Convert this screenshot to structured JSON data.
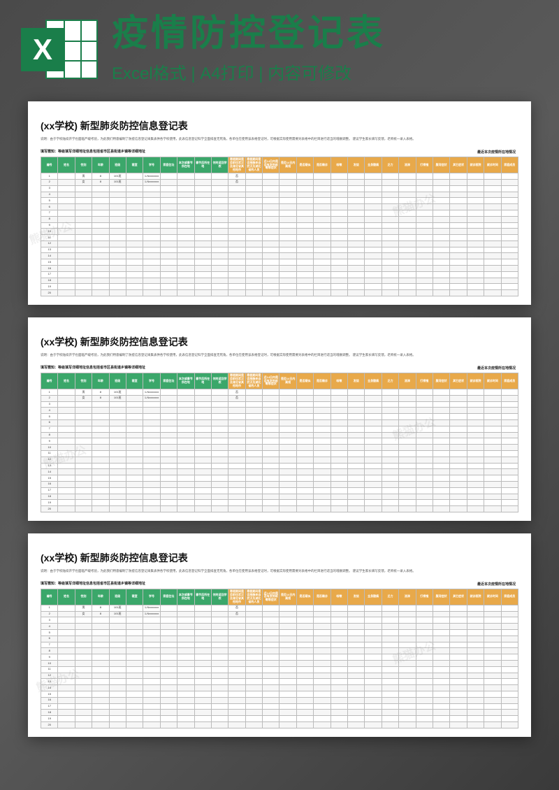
{
  "header": {
    "main_title": "疫情防控登记表",
    "sub_title": "Excel格式 | A4打印 | 内容可修改",
    "icon_letter": "X"
  },
  "page": {
    "title": "(xx学校) 新型肺炎防控信息登记表",
    "desc_line1": "说明：由于学校陆续开学也面临严峻考验，为此我们特意编制了防疫信息登记采集表供各学校使用，此表信息登记科学全面排查无死角，各单位在使用该表格登记时，可根据实际使用需要对表格中的栏目进行适当的增删调整。",
    "desc_line2": "建议学生家长填写反馈，老师统一录入表格。",
    "left_banner": "填写需知：等级填写详细地址信息包括省市区县街道乡镇等详细地址",
    "right_banner": "最近本次疫情所在地情况"
  },
  "columns_green": [
    "编号",
    "姓名",
    "性别",
    "年龄",
    "班级",
    "寝室",
    "学号",
    "家庭住址",
    "本次或春节所在地",
    "春节后所在地",
    "何时返回学校"
  ],
  "columns_orange_pre": [
    "寒假期间是否前往武汉及湖北省其他地市",
    "寒假期间是否接触来自武汉及湖北省的人员",
    "近14日内是否有发热咳嗽等症状"
  ],
  "columns_orange": [
    "是否14日内离境",
    "是否疑似",
    "是否确诊",
    "咳嗽",
    "发烧",
    "全身酸痛",
    "乏力",
    "流涕",
    "打喷嚏",
    "腹泻症状",
    "其它症状",
    "就诊医院",
    "就诊时间",
    "家庭成员"
  ],
  "rows": [
    {
      "no": "1",
      "name": "",
      "sex": "男",
      "age": "8",
      "class": "101班",
      "dorm": "",
      "sid": "1-Nxxxxxxx",
      "a": "",
      "b": "",
      "c": "",
      "d": "",
      "e": "否"
    },
    {
      "no": "2",
      "name": "",
      "sex": "女",
      "age": "8",
      "class": "101班",
      "dorm": "",
      "sid": "1-Nxxxxxxx",
      "a": "",
      "b": "",
      "c": "",
      "d": "",
      "e": "否"
    }
  ],
  "empty_rows_count": 18,
  "watermark": "熊猫办公"
}
